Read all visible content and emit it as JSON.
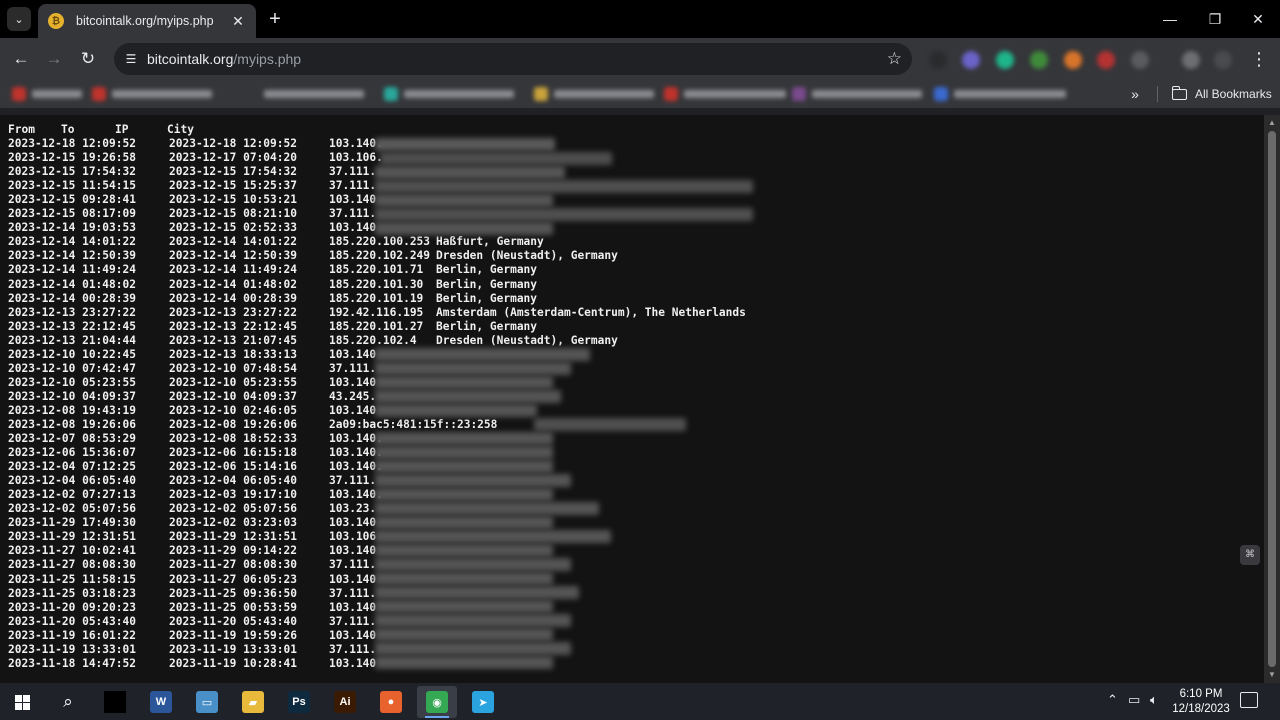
{
  "browser": {
    "tab_title": "bitcointalk.org/myips.php",
    "tab_favicon_letter": "₿",
    "url_host": "bitcointalk.org",
    "url_path": "/myips.php",
    "all_bookmarks_label": "All Bookmarks"
  },
  "colors": {
    "accent_blue": "#6aa6f0",
    "favicon": "#e6b22e",
    "background": "#131313"
  },
  "page": {
    "headers": {
      "from": "From",
      "to": "To",
      "ip": "IP",
      "city": "City"
    },
    "rows": [
      {
        "from": "2023-12-18 12:09:52",
        "to": "2023-12-18 12:09:52",
        "ip": "103.140.",
        "city": ""
      },
      {
        "from": "2023-12-15 19:26:58",
        "to": "2023-12-17 07:04:20",
        "ip": "103.106.",
        "city": ""
      },
      {
        "from": "2023-12-15 17:54:32",
        "to": "2023-12-15 17:54:32",
        "ip": "37.111.",
        "city": ""
      },
      {
        "from": "2023-12-15 11:54:15",
        "to": "2023-12-15 15:25:37",
        "ip": "37.111.",
        "city": ""
      },
      {
        "from": "2023-12-15 09:28:41",
        "to": "2023-12-15 10:53:21",
        "ip": "103.140",
        "city": ""
      },
      {
        "from": "2023-12-15 08:17:09",
        "to": "2023-12-15 08:21:10",
        "ip": "37.111.",
        "city": ""
      },
      {
        "from": "2023-12-14 19:03:53",
        "to": "2023-12-15 02:52:33",
        "ip": "103.140",
        "city": ""
      },
      {
        "from": "2023-12-14 14:01:22",
        "to": "2023-12-14 14:01:22",
        "ip": "185.220.100.253",
        "city": "Haßfurt, Germany"
      },
      {
        "from": "2023-12-14 12:50:39",
        "to": "2023-12-14 12:50:39",
        "ip": "185.220.102.249",
        "city": "Dresden (Neustadt), Germany"
      },
      {
        "from": "2023-12-14 11:49:24",
        "to": "2023-12-14 11:49:24",
        "ip": "185.220.101.71",
        "city": "Berlin, Germany"
      },
      {
        "from": "2023-12-14 01:48:02",
        "to": "2023-12-14 01:48:02",
        "ip": "185.220.101.30",
        "city": "Berlin, Germany"
      },
      {
        "from": "2023-12-14 00:28:39",
        "to": "2023-12-14 00:28:39",
        "ip": "185.220.101.19",
        "city": "Berlin, Germany"
      },
      {
        "from": "2023-12-13 23:27:22",
        "to": "2023-12-13 23:27:22",
        "ip": "192.42.116.195",
        "city": "Amsterdam (Amsterdam-Centrum), The Netherlands"
      },
      {
        "from": "2023-12-13 22:12:45",
        "to": "2023-12-13 22:12:45",
        "ip": "185.220.101.27",
        "city": "Berlin, Germany"
      },
      {
        "from": "2023-12-13 21:04:44",
        "to": "2023-12-13 21:07:45",
        "ip": "185.220.102.4",
        "city": "Dresden (Neustadt), Germany"
      },
      {
        "from": "2023-12-10 10:22:45",
        "to": "2023-12-13 18:33:13",
        "ip": "103.140",
        "city": ""
      },
      {
        "from": "2023-12-10 07:42:47",
        "to": "2023-12-10 07:48:54",
        "ip": "37.111.",
        "city": ""
      },
      {
        "from": "2023-12-10 05:23:55",
        "to": "2023-12-10 05:23:55",
        "ip": "103.140",
        "city": ""
      },
      {
        "from": "2023-12-10 04:09:37",
        "to": "2023-12-10 04:09:37",
        "ip": "43.245.",
        "city": ""
      },
      {
        "from": "2023-12-08 19:43:19",
        "to": "2023-12-10 02:46:05",
        "ip": "103.140",
        "city": ""
      },
      {
        "from": "2023-12-08 19:26:06",
        "to": "2023-12-08 19:26:06",
        "ip": "2a09:bac5:481:15f::23:258",
        "city": ""
      },
      {
        "from": "2023-12-07 08:53:29",
        "to": "2023-12-08 18:52:33",
        "ip": "103.140.",
        "city": ""
      },
      {
        "from": "2023-12-06 15:36:07",
        "to": "2023-12-06 16:15:18",
        "ip": "103.140.",
        "city": ""
      },
      {
        "from": "2023-12-04 07:12:25",
        "to": "2023-12-06 15:14:16",
        "ip": "103.140.",
        "city": ""
      },
      {
        "from": "2023-12-04 06:05:40",
        "to": "2023-12-04 06:05:40",
        "ip": "37.111.",
        "city": ""
      },
      {
        "from": "2023-12-02 07:27:13",
        "to": "2023-12-03 19:17:10",
        "ip": "103.140.",
        "city": ""
      },
      {
        "from": "2023-12-02 05:07:56",
        "to": "2023-12-02 05:07:56",
        "ip": "103.23.",
        "city": ""
      },
      {
        "from": "2023-11-29 17:49:30",
        "to": "2023-12-02 03:23:03",
        "ip": "103.140",
        "city": ""
      },
      {
        "from": "2023-11-29 12:31:51",
        "to": "2023-11-29 12:31:51",
        "ip": "103.106",
        "city": ""
      },
      {
        "from": "2023-11-27 10:02:41",
        "to": "2023-11-29 09:14:22",
        "ip": "103.140",
        "city": ""
      },
      {
        "from": "2023-11-27 08:08:30",
        "to": "2023-11-27 08:08:30",
        "ip": "37.111.",
        "city": ""
      },
      {
        "from": "2023-11-25 11:58:15",
        "to": "2023-11-27 06:05:23",
        "ip": "103.140",
        "city": ""
      },
      {
        "from": "2023-11-25 03:18:23",
        "to": "2023-11-25 09:36:50",
        "ip": "37.111.",
        "city": ""
      },
      {
        "from": "2023-11-20 09:20:23",
        "to": "2023-11-25 00:53:59",
        "ip": "103.140",
        "city": ""
      },
      {
        "from": "2023-11-20 05:43:40",
        "to": "2023-11-20 05:43:40",
        "ip": "37.111.",
        "city": ""
      },
      {
        "from": "2023-11-19 16:01:22",
        "to": "2023-11-19 19:59:26",
        "ip": "103.140",
        "city": ""
      },
      {
        "from": "2023-11-19 13:33:01",
        "to": "2023-11-19 13:33:01",
        "ip": "37.111.",
        "city": ""
      },
      {
        "from": "2023-11-18 14:47:52",
        "to": "2023-11-19 10:28:41",
        "ip": "103.140",
        "city": ""
      }
    ]
  },
  "taskbar": {
    "apps": [
      {
        "name": "word-app-icon",
        "glyph": "W",
        "color": "#2b579a"
      },
      {
        "name": "explorer-app-icon",
        "glyph": "▭",
        "color": "#4a90c8"
      },
      {
        "name": "file-manager-icon",
        "glyph": "▰",
        "color": "#e8b93a"
      },
      {
        "name": "photoshop-app-icon",
        "glyph": "Ps",
        "color": "#0d2a3f"
      },
      {
        "name": "illustrator-app-icon",
        "glyph": "Ai",
        "color": "#3a1a02"
      },
      {
        "name": "firefox-app-icon",
        "glyph": "●",
        "color": "#e8622d"
      },
      {
        "name": "chrome-app-icon",
        "glyph": "◉",
        "color": "#34a853"
      },
      {
        "name": "telegram-app-icon",
        "glyph": "➤",
        "color": "#2aa3df"
      }
    ],
    "time": "6:10 PM",
    "date": "12/18/2023"
  }
}
